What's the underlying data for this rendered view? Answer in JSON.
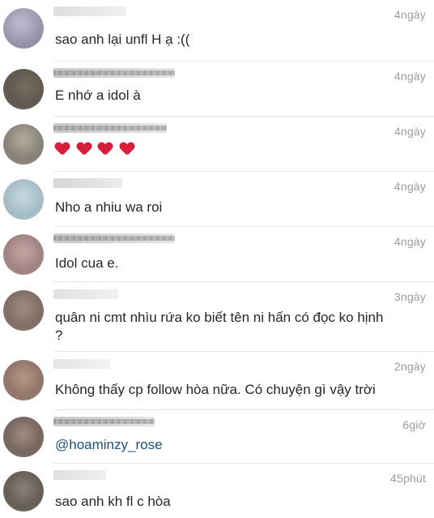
{
  "comments": [
    {
      "time": "4ngày",
      "text": "sao anh lại unfl H ạ :(("
    },
    {
      "time": "4ngày",
      "text": "E nhớ a idol à"
    },
    {
      "time": "4ngày",
      "text": "",
      "hearts": 4
    },
    {
      "time": "4ngày",
      "text": "Nho a nhiu wa roi"
    },
    {
      "time": "4ngày",
      "text": "Idol cua e."
    },
    {
      "time": "3ngày",
      "text": "quân ni cmt nhìu rứa ko biết tên ni hấn có đọc ko hịnh",
      "text2": "?"
    },
    {
      "time": "2ngày",
      "text": "Không thấy cp follow hòa nữa. Có chuyện gì vậy trời"
    },
    {
      "time": "6giờ",
      "text": "@hoaminzy_rose"
    },
    {
      "time": "45phút",
      "text": "sao anh kh fl c hòa"
    }
  ],
  "colors": {
    "text": "#262626",
    "timestamp": "#9b9b9b",
    "mention": "#1f4f7a",
    "heart": "#d6203a"
  }
}
